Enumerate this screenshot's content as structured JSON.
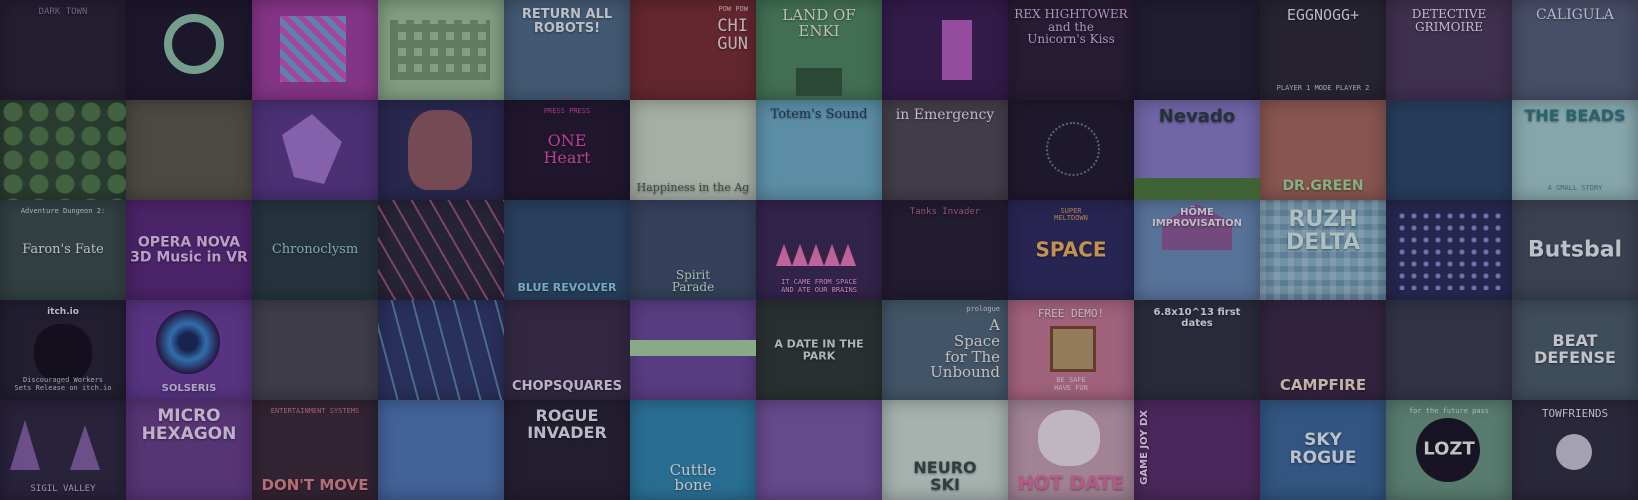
{
  "tiles": [
    {
      "title": "DARK TOWN",
      "bg": "#2a2233",
      "fg": "#8a7fa0",
      "font": "mono",
      "size": 9,
      "pos": "top",
      "deco": ""
    },
    {
      "title": "",
      "bg": "#1f1a2e",
      "fg": "#8fc8a8",
      "font": "sans",
      "size": 12,
      "pos": "mid",
      "deco": "ring"
    },
    {
      "title": "",
      "bg": "#a33fa0",
      "fg": "#7ce0e0",
      "font": "sans",
      "size": 12,
      "pos": "mid",
      "deco": "robot"
    },
    {
      "title": "",
      "bg": "#9fc79a",
      "fg": "#2e4a2e",
      "font": "mono",
      "size": 12,
      "pos": "mid",
      "deco": "blocks"
    },
    {
      "title": "RETURN ALL\nROBOTS!",
      "bg": "#4f6f88",
      "fg": "#e8f2f5",
      "font": "sans",
      "size": 13,
      "pos": "top",
      "deco": ""
    },
    {
      "title": "CHI\nGUN",
      "sub": "POW POW",
      "bg": "#7a2e32",
      "fg": "#f2dada",
      "font": "mono",
      "size": 17,
      "pos": "right",
      "deco": ""
    },
    {
      "title": "LAND OF\nENKI",
      "bg": "#4f8a60",
      "fg": "#e9f4dc",
      "font": "serif",
      "size": 15,
      "pos": "top",
      "deco": "steps"
    },
    {
      "title": "",
      "bg": "#3a1f52",
      "fg": "#d86fd8",
      "font": "sans",
      "size": 12,
      "pos": "mid",
      "deco": "bars"
    },
    {
      "title": "REX HIGHTOWER\nand the\nUnicorn's Kiss",
      "bg": "#2b2036",
      "fg": "#d9b9e8",
      "font": "serif",
      "size": 12,
      "pos": "top",
      "deco": ""
    },
    {
      "title": "",
      "bg": "#232034",
      "fg": "#6a6a7a",
      "font": "sans",
      "size": 12,
      "pos": "mid",
      "deco": ""
    },
    {
      "title": "EGGNOGG+",
      "sub": "PLAYER 1   MODE   PLAYER 2",
      "bg": "#2c2a34",
      "fg": "#dce8e8",
      "font": "mono",
      "size": 15,
      "pos": "top",
      "deco": ""
    },
    {
      "title": "DETECTIVE\nGRIMOIRE",
      "bg": "#4a3a5a",
      "fg": "#f3eef8",
      "font": "serif",
      "size": 12,
      "pos": "top",
      "deco": ""
    },
    {
      "title": "CALIGULA",
      "bg": "#56607a",
      "fg": "#dfe6ef",
      "font": "serif",
      "size": 14,
      "pos": "top",
      "deco": ""
    },
    {
      "title": "",
      "bg": "#2f4a32",
      "fg": "#8dc08a",
      "font": "sans",
      "size": 12,
      "pos": "mid",
      "deco": "trees"
    },
    {
      "title": "",
      "bg": "#5a5a48",
      "fg": "#b9b894",
      "font": "sans",
      "size": 12,
      "pos": "mid",
      "deco": ""
    },
    {
      "title": "",
      "bg": "#5a3a8a",
      "fg": "#b58ae0",
      "font": "sans",
      "size": 12,
      "pos": "mid",
      "deco": "shards"
    },
    {
      "title": "",
      "bg": "#2e2f58",
      "fg": "#e07f6a",
      "font": "sans",
      "size": 12,
      "pos": "mid",
      "deco": "face"
    },
    {
      "title": "ONE\nHeart",
      "sub": "PRESS   PRESS",
      "bg": "#231a30",
      "fg": "#e44fb0",
      "font": "serif",
      "size": 16,
      "pos": "mid",
      "deco": ""
    },
    {
      "title": "Happiness in the Ag",
      "bg": "#cfdcc8",
      "fg": "#4a5a48",
      "font": "serif",
      "size": 11,
      "pos": "bottom",
      "deco": ""
    },
    {
      "title": "Totem's Sound",
      "bg": "#6fb3c8",
      "fg": "#1f3a5a",
      "font": "serif",
      "size": 13,
      "pos": "top",
      "deco": ""
    },
    {
      "title": "in Emergency",
      "bg": "#4f4a52",
      "fg": "#f5e6ef",
      "font": "serif",
      "size": 14,
      "pos": "top",
      "deco": ""
    },
    {
      "title": "",
      "bg": "#211c2e",
      "fg": "#6a7a9a",
      "font": "sans",
      "size": 12,
      "pos": "mid",
      "deco": "dots"
    },
    {
      "title": "Nevado",
      "bg": "#8a7ec8",
      "fg": "#2a3d3a",
      "font": "sans",
      "size": 18,
      "pos": "top",
      "deco": "hills"
    },
    {
      "title": "DR.GREEN",
      "bg": "#a86a5a",
      "fg": "#9fe09a",
      "font": "sans",
      "size": 14,
      "pos": "bottom",
      "deco": ""
    },
    {
      "title": "",
      "bg": "#2c4a6a",
      "fg": "#6fa6d8",
      "font": "sans",
      "size": 12,
      "pos": "mid",
      "deco": ""
    },
    {
      "title": "THE BEADS",
      "sub": "A SMALL STORY",
      "bg": "#a6d2cf",
      "fg": "#2f7a84",
      "font": "sans",
      "size": 16,
      "pos": "top",
      "deco": ""
    },
    {
      "title": "Faron's Fate",
      "sub": "Adventure Dungeon 2:",
      "bg": "#3a4f4a",
      "fg": "#e8f2ee",
      "font": "serif",
      "size": 13,
      "pos": "mid",
      "deco": ""
    },
    {
      "title": "OPERA NOVA\n3D Music in VR",
      "bg": "#5a2a7a",
      "fg": "#e7c9f5",
      "font": "sans",
      "size": 14,
      "pos": "mid",
      "deco": ""
    },
    {
      "title": "Chronoclysm",
      "bg": "#2a3e42",
      "fg": "#9fd6d2",
      "font": "serif",
      "size": 13,
      "pos": "mid",
      "deco": ""
    },
    {
      "title": "",
      "bg": "#2c2a3a",
      "fg": "#e06fa8",
      "font": "sans",
      "size": 12,
      "pos": "mid",
      "deco": "stripes"
    },
    {
      "title": "BLUE REVOLVER",
      "bg": "#2f4e6e",
      "fg": "#8ed6f0",
      "font": "sans",
      "size": 11,
      "pos": "bottom",
      "deco": ""
    },
    {
      "title": "Spirit\nParade",
      "bg": "#3f4f6a",
      "fg": "#c8f2d2",
      "font": "serif",
      "size": 12,
      "pos": "bottom",
      "deco": ""
    },
    {
      "title": "IT CAME FROM SPACE\nAND ATE OUR BRAINS",
      "bg": "#3a2a55",
      "fg": "#f0a8d8",
      "font": "mono",
      "size": 7,
      "pos": "bottom",
      "deco": "spikes"
    },
    {
      "title": "Tanks   Invader",
      "bg": "#262033",
      "fg": "#b46a8a",
      "font": "mono",
      "size": 9,
      "pos": "top",
      "deco": ""
    },
    {
      "title": "SPACE",
      "sub": "SUPER\nMELTDOWN",
      "bg": "#2d2c5e",
      "fg": "#f2b85a",
      "font": "sans",
      "size": 20,
      "pos": "mid",
      "deco": ""
    },
    {
      "title": "HÖME\nIMPROVISATION",
      "bg": "#6a8fb8",
      "fg": "#f2ecf5",
      "font": "sans",
      "size": 10,
      "pos": "top",
      "deco": "house"
    },
    {
      "title": "RUZH\nDELTA",
      "bg": "#8ab8c8",
      "fg": "#d8f2ec",
      "font": "sans",
      "size": 22,
      "pos": "top",
      "deco": "plaid"
    },
    {
      "title": "",
      "bg": "#2a2f5a",
      "fg": "#8a8fd8",
      "font": "sans",
      "size": 12,
      "pos": "mid",
      "deco": "grid"
    },
    {
      "title": "Butsbal",
      "bg": "#46505e",
      "fg": "#eef2f5",
      "font": "sans",
      "size": 22,
      "pos": "mid",
      "deco": ""
    },
    {
      "title": "itch.io",
      "sub": "Discouraged Workers\nSets Release on itch.io",
      "bg": "#262333",
      "fg": "#e8e8ee",
      "font": "sans",
      "size": 9,
      "pos": "top",
      "deco": "eye"
    },
    {
      "title": "SOLSERIS",
      "bg": "#6a3f9a",
      "fg": "#dcd2f2",
      "font": "sans",
      "size": 10,
      "pos": "bottom",
      "deco": "vortex"
    },
    {
      "title": "",
      "bg": "#4a4a52",
      "fg": "#b8b8c2",
      "font": "sans",
      "size": 12,
      "pos": "mid",
      "deco": ""
    },
    {
      "title": "",
      "bg": "#2f3a6a",
      "fg": "#8fd6e8",
      "font": "sans",
      "size": 12,
      "pos": "mid",
      "deco": "lasers"
    },
    {
      "title": "CHOPSQUARES",
      "bg": "#3a2f4a",
      "fg": "#e8e2f2",
      "font": "sans",
      "size": 13,
      "pos": "bottom",
      "deco": ""
    },
    {
      "title": "",
      "bg": "#6b4a9a",
      "fg": "#b8e0b0",
      "font": "sans",
      "size": 12,
      "pos": "mid",
      "deco": "platform"
    },
    {
      "title": "A DATE IN THE PARK",
      "bg": "#2f3a34",
      "fg": "#d6e6dc",
      "font": "sans",
      "size": 11,
      "pos": "mid",
      "deco": ""
    },
    {
      "title": "A\nSpace\nfor The\nUnbound",
      "sub": "prologue",
      "bg": "#4f6a7a",
      "fg": "#f2f0e8",
      "font": "serif",
      "size": 15,
      "pos": "right",
      "deco": ""
    },
    {
      "title": "FREE DEMO!",
      "sub": "BE SAFE\nHAVE FUN",
      "bg": "#c87a94",
      "fg": "#f5e8ee",
      "font": "mono",
      "size": 11,
      "pos": "top",
      "deco": "frame"
    },
    {
      "title": "6.8x10^13 first dates",
      "bg": "#2f3440",
      "fg": "#eef0f4",
      "font": "sans",
      "size": 10,
      "pos": "top",
      "deco": ""
    },
    {
      "title": "CAMPFIRE",
      "bg": "#3a2a45",
      "fg": "#f2e2c8",
      "font": "sans",
      "size": 15,
      "pos": "bottom",
      "deco": ""
    },
    {
      "title": "",
      "bg": "#3a3f4f",
      "fg": "#8a92a8",
      "font": "sans",
      "size": 12,
      "pos": "mid",
      "deco": ""
    },
    {
      "title": "BEAT\nDEFENSE",
      "bg": "#4a5f6a",
      "fg": "#f2f5f5",
      "font": "sans",
      "size": 16,
      "pos": "mid",
      "deco": ""
    },
    {
      "title": "SIGIL VALLEY",
      "bg": "#2e2840",
      "fg": "#c8b8e2",
      "font": "mono",
      "size": 9,
      "pos": "bottom",
      "deco": "spires"
    },
    {
      "title": "MICRO\nHEXAGON",
      "bg": "#6a3f8a",
      "fg": "#ece0f5",
      "font": "sans",
      "size": 17,
      "pos": "top",
      "deco": ""
    },
    {
      "title": "DON'T MOVE",
      "sub": "ENTERTAINMENT SYSTEMS",
      "bg": "#3a2a35",
      "fg": "#e08a8a",
      "font": "sans",
      "size": 15,
      "pos": "bottom",
      "deco": ""
    },
    {
      "title": "",
      "bg": "#4f7ab8",
      "fg": "#f2e8f5",
      "font": "sans",
      "size": 12,
      "pos": "mid",
      "deco": ""
    },
    {
      "title": "ROGUE\nINVADER",
      "bg": "#262330",
      "fg": "#e8e8f0",
      "font": "sans",
      "size": 16,
      "pos": "top",
      "deco": ""
    },
    {
      "title": "Cuttle\nbone",
      "bg": "#2f8ab0",
      "fg": "#f2f8fa",
      "font": "serif",
      "size": 15,
      "pos": "bottom",
      "deco": ""
    },
    {
      "title": "",
      "bg": "#7a5aa8",
      "fg": "#f28ab8",
      "font": "sans",
      "size": 12,
      "pos": "mid",
      "deco": ""
    },
    {
      "title": "NEURO\nSKI",
      "bg": "#cfe0d4",
      "fg": "#3a4a44",
      "font": "sans",
      "size": 16,
      "pos": "bottom",
      "deco": ""
    },
    {
      "title": "HOT DATE",
      "bg": "#c8a4b2",
      "fg": "#e06fa0",
      "font": "sans",
      "size": 19,
      "pos": "bottom",
      "deco": "pug"
    },
    {
      "title": "GAME JOY DX",
      "bg": "#5a2f6a",
      "fg": "#f2e2f8",
      "font": "sans",
      "size": 10,
      "pos": "left",
      "deco": ""
    },
    {
      "title": "SKY\nROGUE",
      "bg": "#3a6a9a",
      "fg": "#eaf4fa",
      "font": "sans",
      "size": 17,
      "pos": "mid",
      "deco": ""
    },
    {
      "title": "LOZT",
      "sub": "for the future pass",
      "bg": "#6a9a82",
      "fg": "#eef5ec",
      "font": "sans",
      "size": 18,
      "pos": "mid",
      "deco": "orb"
    },
    {
      "title": "TOWFRIENDS",
      "bg": "#2f2f3f",
      "fg": "#e8e8f2",
      "font": "mono",
      "size": 11,
      "pos": "top",
      "deco": "bubble"
    }
  ]
}
